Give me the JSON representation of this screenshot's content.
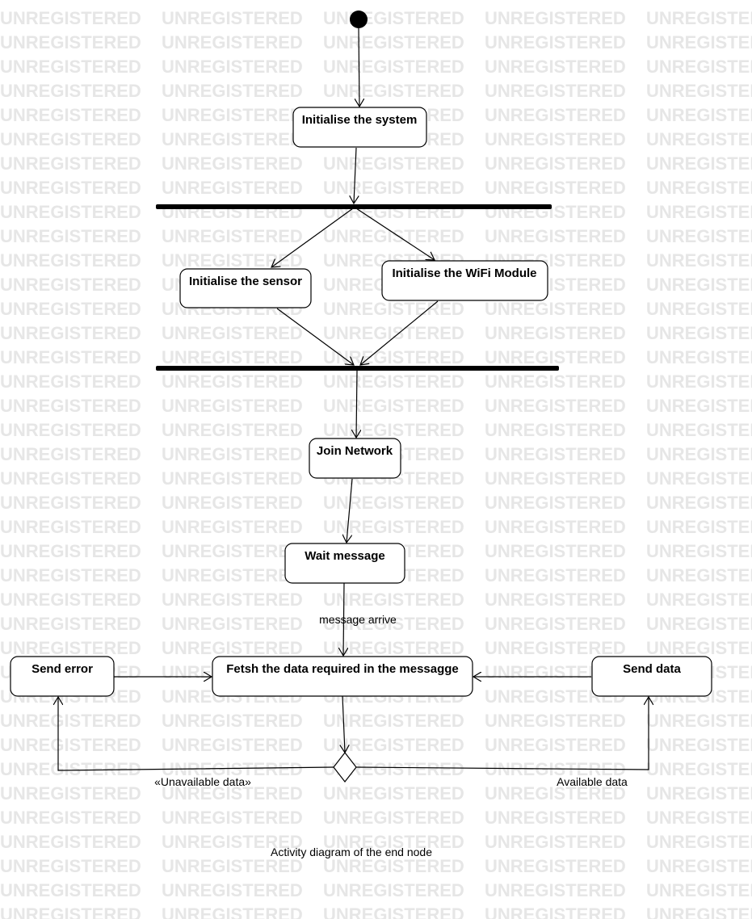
{
  "watermark": {
    "text": "UNREGISTERED",
    "color": "#e6e6e6"
  },
  "nodes": {
    "init_system": "Initialise the system",
    "init_sensor": "Initialise the sensor",
    "init_wifi": "Initialise the WiFi Module",
    "join_network": "Join Network",
    "wait_message": "Wait message",
    "fetch_data": "Fetsh the data required in the messagge",
    "send_error": "Send error",
    "send_data": "Send data"
  },
  "guards": {
    "message_arrive": "message arrive",
    "unavailable": "«Unavailable data»",
    "available": "Available data"
  },
  "caption": "Activity diagram of the end node"
}
